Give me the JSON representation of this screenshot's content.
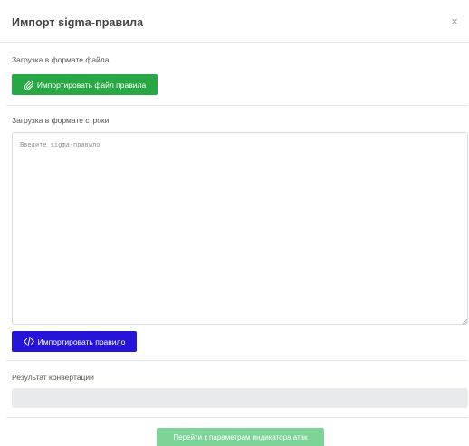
{
  "modal": {
    "title": "Импорт sigma-правила",
    "close_label": "×"
  },
  "file_section": {
    "label": "Загрузка в формате файла",
    "button_label": "Импортировать файл правила",
    "button_icon": "paperclip-icon"
  },
  "string_section": {
    "label": "Загрузка в формате строки",
    "textarea_value": "",
    "textarea_placeholder": "Введите sigma-правило",
    "button_label": "Импортировать правило",
    "button_icon": "code-icon"
  },
  "result_section": {
    "label": "Результат конвертации",
    "value": ""
  },
  "footer": {
    "next_button_label": "Перейти к параметрам индикатора атак"
  },
  "colors": {
    "file_button": "#28a745",
    "rule_button": "#2614d8",
    "next_button": "#7dd497",
    "result_field_bg": "#e8eaed"
  }
}
